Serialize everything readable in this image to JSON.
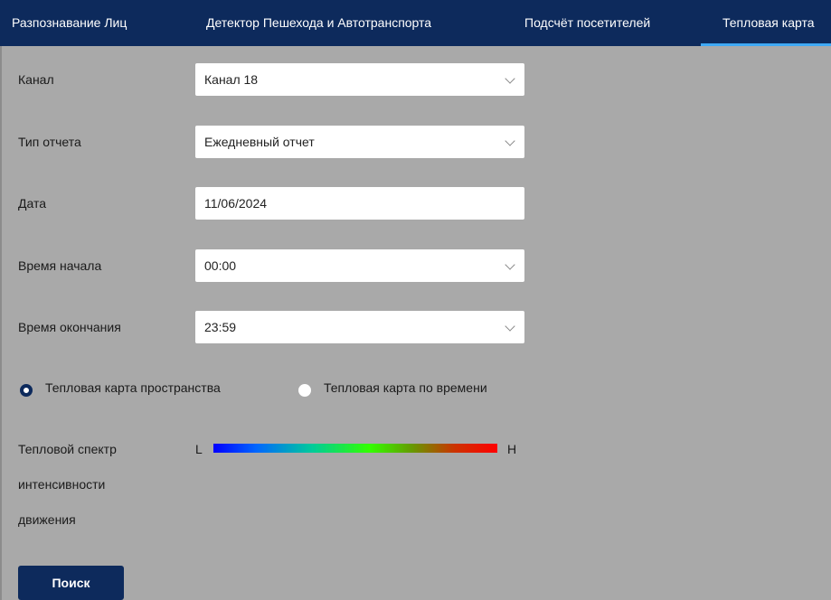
{
  "tabs": [
    {
      "label": "Разпознавание Лиц"
    },
    {
      "label": "Детектор Пешехода и Автотранспорта"
    },
    {
      "label": "Подсчёт посетителей"
    },
    {
      "label": "Тепловая карта"
    }
  ],
  "form": {
    "channel": {
      "label": "Канал",
      "value": "Канал 18"
    },
    "report_type": {
      "label": "Тип отчета",
      "value": "Ежедневный отчет"
    },
    "date": {
      "label": "Дата",
      "value": "11/06/2024"
    },
    "start_time": {
      "label": "Время начала",
      "value": "00:00"
    },
    "end_time": {
      "label": "Время окончания",
      "value": "23:59"
    }
  },
  "mode": {
    "space_label": "Тепловая карта пространства",
    "time_label": "Тепловая карта по времени",
    "selected": "space"
  },
  "spectrum": {
    "label_line1": "Тепловой спектр",
    "label_line2": "интенсивности",
    "label_line3": "движения",
    "low": "L",
    "high": "H"
  },
  "search_button": "Поиск",
  "colors": {
    "accent": "#0d2a5c",
    "tab_underline": "#3fa9f5",
    "background": "#a9a9a9"
  }
}
